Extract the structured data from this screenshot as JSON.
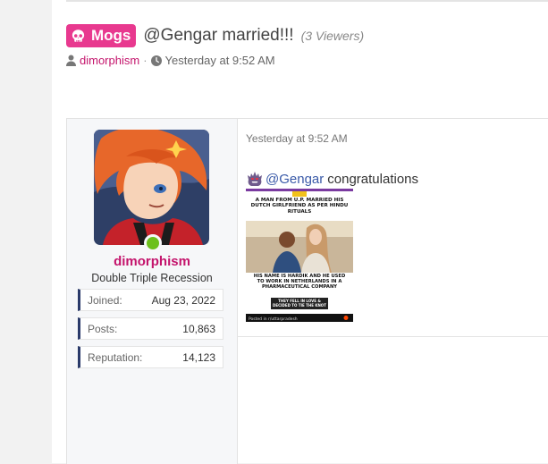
{
  "thread": {
    "prefix": "Mogs",
    "title": "@Gengar married!!!",
    "viewers": "(3 Viewers)"
  },
  "meta": {
    "author": "dimorphism",
    "separator": "·",
    "time": "Yesterday at 9:52 AM"
  },
  "post": {
    "author": {
      "name": "dimorphism",
      "title": "Double Triple Recession",
      "stats": [
        {
          "label": "Joined:",
          "value": "Aug 23, 2022"
        },
        {
          "label": "Posts:",
          "value": "10,863"
        },
        {
          "label": "Reputation:",
          "value": "14,123"
        }
      ]
    },
    "time": "Yesterday at 9:52 AM",
    "mention": "@Gengar",
    "message": "congratulations",
    "image": {
      "headline": "A MAN FROM U.P. MARRIED HIS DUTCH GIRLFRIEND AS PER HINDU RITUALS",
      "body": "HIS NAME IS HARDIK AND HE USED TO WORK IN NETHERLANDS IN A PHARMACEUTICAL COMPANY",
      "banner": "THEY FELL IN LOVE & DECIDED TO TIE THE KNOT",
      "footer": "Posted in r/uttarpradesh"
    }
  },
  "colors": {
    "prefix_bg": "#e8398f",
    "username": "#c4146c",
    "online": "#6cc01c",
    "stat_accent": "#2a3a6a"
  },
  "icons": [
    "skull-icon",
    "user-icon",
    "clock-icon",
    "gengar-icon",
    "online-indicator"
  ]
}
